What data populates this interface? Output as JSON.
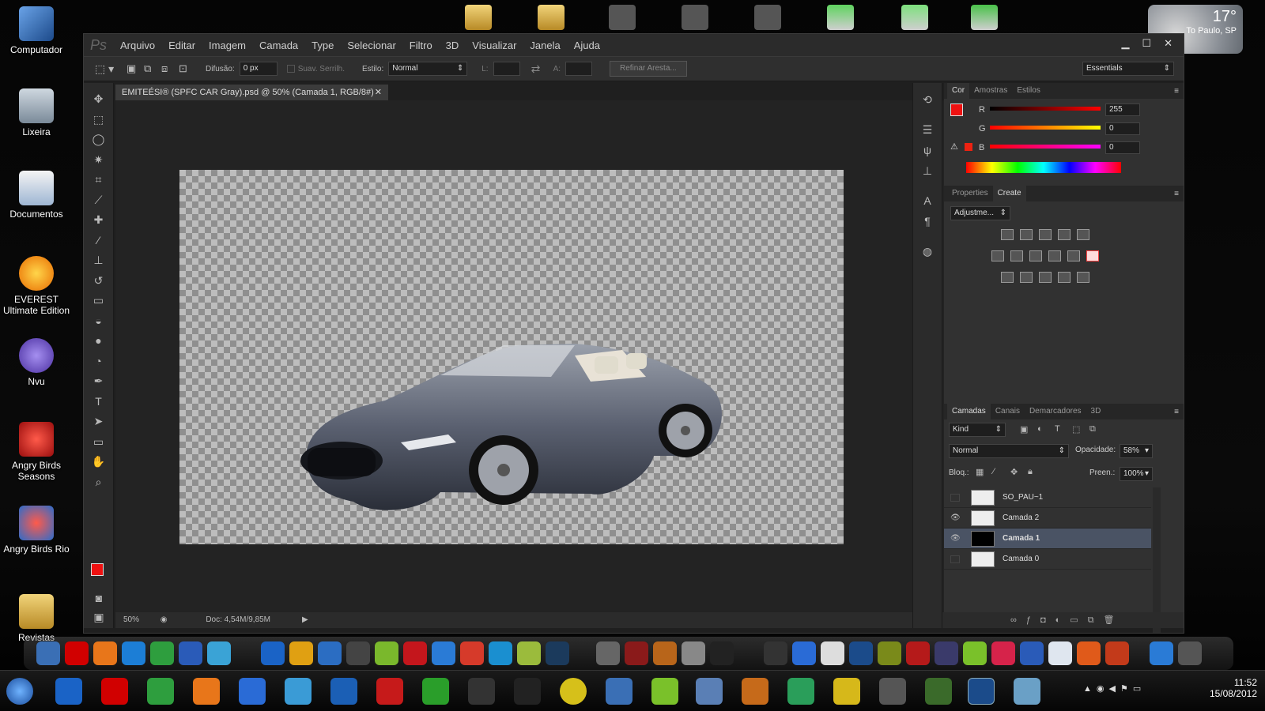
{
  "desktop": {
    "icons": [
      {
        "label": "Computador"
      },
      {
        "label": "Lixeira"
      },
      {
        "label": "Documentos"
      },
      {
        "label": "EVEREST Ultimate Edition"
      },
      {
        "label": "Nvu"
      },
      {
        "label": "Angry Birds Seasons"
      },
      {
        "label": "Angry Birds Rio"
      },
      {
        "label": "Revistas"
      }
    ],
    "weather": {
      "temp": "17°",
      "city": "To Paulo, SP"
    }
  },
  "photoshop": {
    "logo": "Ps",
    "menu": [
      "Arquivo",
      "Editar",
      "Imagem",
      "Camada",
      "Type",
      "Selecionar",
      "Filtro",
      "3D",
      "Visualizar",
      "Janela",
      "Ajuda"
    ],
    "options": {
      "difusao_label": "Difusão:",
      "difusao_value": "0 px",
      "suav_label": "Suav. Serrilh.",
      "estilo_label": "Estilo:",
      "estilo_value": "Normal",
      "l_label": "L:",
      "a_label": "A:",
      "refine": "Refinar Aresta...",
      "workspace": "Essentials"
    },
    "doc_tab": "EMITEÉSI® (SPFC CAR Gray).psd @ 50% (Camada 1, RGB/8#)",
    "status": {
      "zoom": "50%",
      "doc": "Doc: 4,54M/9,85M"
    },
    "color_panel": {
      "tabs": [
        "Cor",
        "Amostras",
        "Estilos"
      ],
      "channels": [
        {
          "name": "R",
          "value": "255"
        },
        {
          "name": "G",
          "value": "0"
        },
        {
          "name": "B",
          "value": "0"
        }
      ],
      "fg_color": "#ee1111"
    },
    "props_panel": {
      "tabs": [
        "Properties",
        "Create"
      ],
      "dropdown": "Adjustme..."
    },
    "layers_panel": {
      "tabs": [
        "Camadas",
        "Canais",
        "Demarcadores",
        "3D"
      ],
      "kind": "Kind",
      "blend": "Normal",
      "opacity_label": "Opacidade:",
      "opacity": "58%",
      "lock_label": "Bloq.:",
      "fill_label": "Preen.:",
      "fill": "100%",
      "layers": [
        {
          "name": "SO_PAU~1",
          "visible": false,
          "selected": false
        },
        {
          "name": "Camada 2",
          "visible": true,
          "selected": false
        },
        {
          "name": "Camada 1",
          "visible": true,
          "selected": true
        },
        {
          "name": "Camada 0",
          "visible": false,
          "selected": false
        }
      ]
    }
  },
  "taskbar": {
    "time": "11:52",
    "date": "15/08/2012"
  }
}
